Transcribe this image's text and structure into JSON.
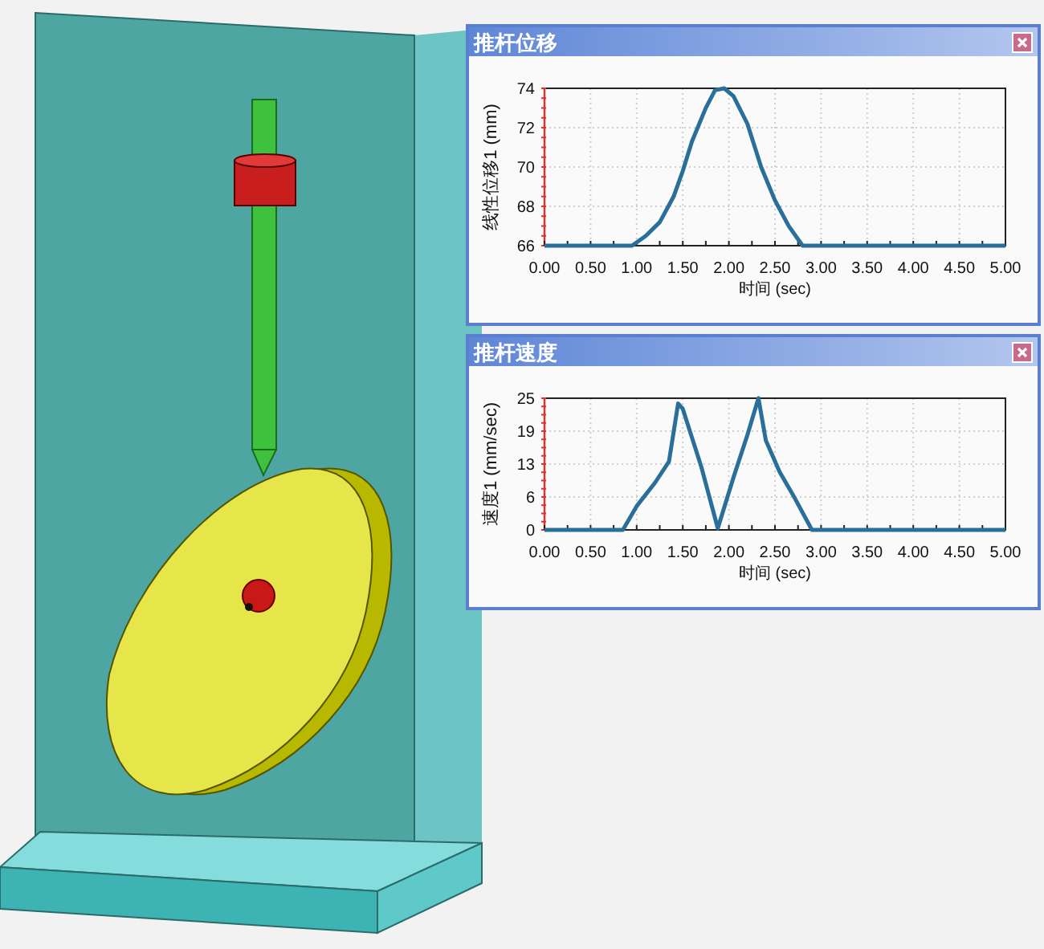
{
  "windows": [
    {
      "title": "推杆位移",
      "chart_data": {
        "type": "line",
        "xlabel": "时间 (sec)",
        "ylabel": "线性位移1 (mm)",
        "x": [
          0,
          0.5,
          0.95,
          1.1,
          1.25,
          1.4,
          1.5,
          1.6,
          1.75,
          1.85,
          1.95,
          2.05,
          2.2,
          2.35,
          2.5,
          2.65,
          2.8,
          3.0,
          3.5,
          4.0,
          4.5,
          5.0
        ],
        "grid": true,
        "series": [
          {
            "color": "#2a6f9a",
            "values": [
              66,
              66,
              66,
              66.5,
              67.2,
              68.5,
              69.8,
              71.3,
              73,
              73.9,
              74,
              73.6,
              72.2,
              70,
              68.3,
              67,
              66,
              66,
              66,
              66,
              66,
              66
            ]
          }
        ],
        "xlim": [
          0,
          5
        ],
        "ylim": [
          66,
          74
        ],
        "xticks": [
          {
            "value": 0,
            "label": "0.00"
          },
          {
            "value": 0.5,
            "label": "0.50"
          },
          {
            "value": 1,
            "label": "1.00"
          },
          {
            "value": 1.5,
            "label": "1.50"
          },
          {
            "value": 2,
            "label": "2.00"
          },
          {
            "value": 2.5,
            "label": "2.50"
          },
          {
            "value": 3,
            "label": "3.00"
          },
          {
            "value": 3.5,
            "label": "3.50"
          },
          {
            "value": 4,
            "label": "4.00"
          },
          {
            "value": 4.5,
            "label": "4.50"
          },
          {
            "value": 5,
            "label": "5.00"
          }
        ],
        "yticks": [
          66,
          68,
          70,
          72,
          74
        ]
      }
    },
    {
      "title": "推杆速度",
      "chart_data": {
        "type": "line",
        "xlabel": "时间 (sec)",
        "ylabel": "速度1 (mm/sec)",
        "x": [
          0,
          0.5,
          0.85,
          1.0,
          1.2,
          1.35,
          1.45,
          1.5,
          1.7,
          1.88,
          2.05,
          2.2,
          2.32,
          2.4,
          2.55,
          2.7,
          2.9,
          3.0,
          3.5,
          4.0,
          4.5,
          5.0
        ],
        "grid": true,
        "series": [
          {
            "color": "#2a6f9a",
            "values": [
              0,
              0,
              0,
              4.5,
              9,
              13,
              24,
              23,
              12,
              0.3,
              10,
              18,
              25,
              17,
              11,
              6.5,
              0,
              0,
              0,
              0,
              0,
              0
            ]
          }
        ],
        "xlim": [
          0,
          5
        ],
        "ylim": [
          0,
          25
        ],
        "xticks": [
          {
            "value": 0,
            "label": "0.00"
          },
          {
            "value": 0.5,
            "label": "0.50"
          },
          {
            "value": 1,
            "label": "1.00"
          },
          {
            "value": 1.5,
            "label": "1.50"
          },
          {
            "value": 2,
            "label": "2.00"
          },
          {
            "value": 2.5,
            "label": "2.50"
          },
          {
            "value": 3,
            "label": "3.00"
          },
          {
            "value": 3.5,
            "label": "3.50"
          },
          {
            "value": 4,
            "label": "4.00"
          },
          {
            "value": 4.5,
            "label": "4.50"
          },
          {
            "value": 5,
            "label": "5.00"
          }
        ],
        "yticks": [
          0,
          {
            "value": 6.25,
            "label": "6"
          },
          {
            "value": 12.5,
            "label": "13"
          },
          {
            "value": 18.75,
            "label": "19"
          },
          25
        ]
      }
    }
  ]
}
